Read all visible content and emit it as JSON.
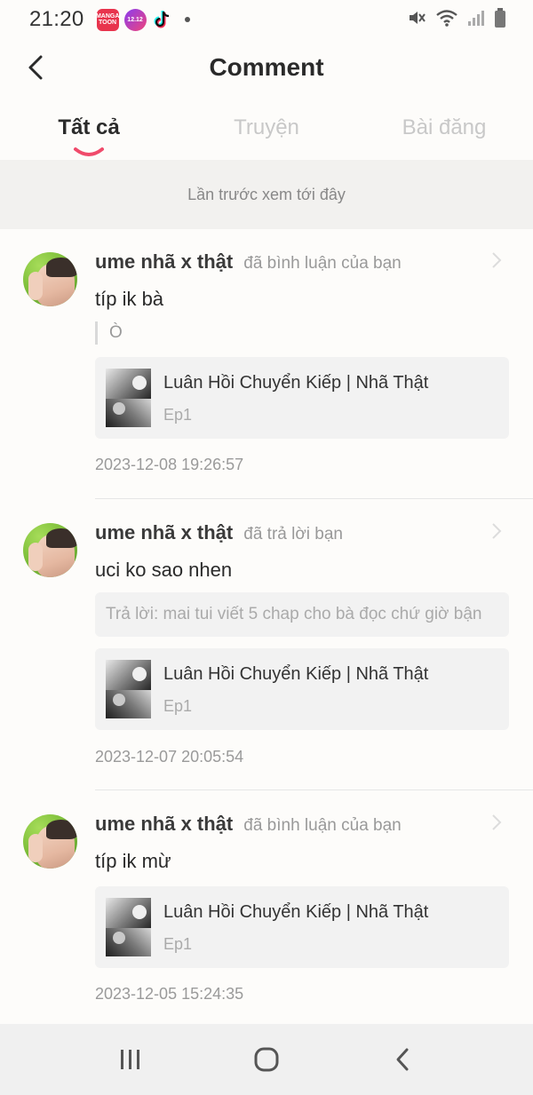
{
  "status_bar": {
    "time": "21:20",
    "apps": [
      {
        "name": "mangatoon-app-icon",
        "label": "MANGA TOON"
      },
      {
        "name": "shopee-sale-app-icon",
        "label": "12.12"
      },
      {
        "name": "tiktok-app-icon",
        "label": ""
      }
    ],
    "right_icons": [
      "mute-icon",
      "wifi-icon",
      "signal-icon",
      "battery-icon"
    ]
  },
  "header": {
    "title": "Comment",
    "back_icon": "chevron-left-icon"
  },
  "tabs": [
    {
      "label": "Tất cả",
      "active": true
    },
    {
      "label": "Truyện",
      "active": false
    },
    {
      "label": "Bài đăng",
      "active": false
    }
  ],
  "banner": "Lần trước xem tới đây",
  "notifications": [
    {
      "username": "ume nhã x thật",
      "action": "đã bình luận của bạn",
      "comment": "típ ik bà",
      "quote": "Ò",
      "reply": "",
      "story": {
        "title": "Luân Hồi Chuyển Kiếp | Nhã Thật",
        "episode": "Ep1"
      },
      "timestamp": "2023-12-08 19:26:57"
    },
    {
      "username": "ume nhã x thật",
      "action": "đã trả lời bạn",
      "comment": "uci ko sao nhen",
      "quote": "",
      "reply": "Trả lời: mai tui viết 5 chap cho bà đọc chứ giờ bận",
      "story": {
        "title": "Luân Hồi Chuyển Kiếp | Nhã Thật",
        "episode": "Ep1"
      },
      "timestamp": "2023-12-07 20:05:54"
    },
    {
      "username": "ume nhã x thật",
      "action": "đã bình luận của bạn",
      "comment": "típ ik mừ",
      "quote": "",
      "reply": "",
      "story": {
        "title": "Luân Hồi Chuyển Kiếp | Nhã Thật",
        "episode": "Ep1"
      },
      "timestamp": "2023-12-05 15:24:35"
    }
  ],
  "nav_bar": {
    "icons": [
      "recent-apps-icon",
      "home-icon",
      "back-icon"
    ]
  },
  "colors": {
    "accent": "#f04b6b",
    "banner_bg": "#f2f1ef",
    "card_bg": "#f2f2f2"
  }
}
